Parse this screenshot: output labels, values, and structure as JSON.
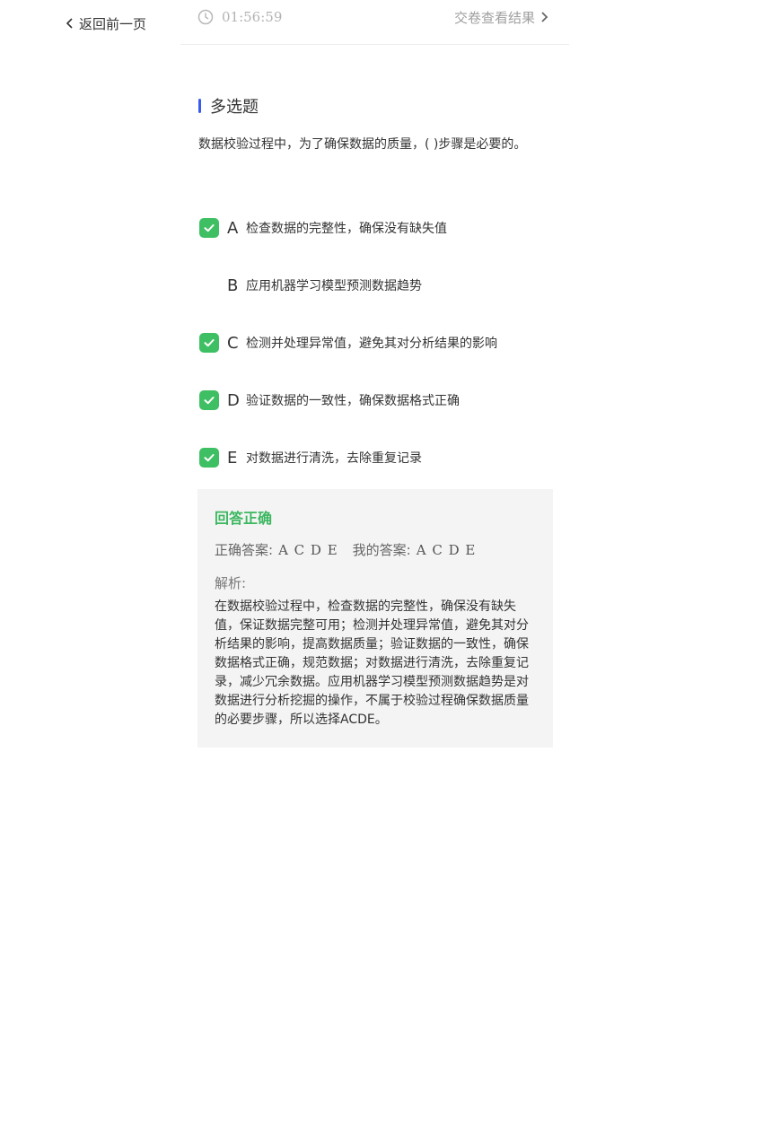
{
  "nav": {
    "back_label": "返回前一页"
  },
  "topbar": {
    "timer": "01:56:59",
    "submit_label": "交卷查看结果"
  },
  "question": {
    "type_label": "多选题",
    "stem": "数据校验过程中，为了确保数据的质量，( )步骤是必要的。",
    "options": [
      {
        "letter": "A",
        "text": "检查数据的完整性，确保没有缺失值",
        "checked": true
      },
      {
        "letter": "B",
        "text": "应用机器学习模型预测数据趋势",
        "checked": false
      },
      {
        "letter": "C",
        "text": "检测并处理异常值，避免其对分析结果的影响",
        "checked": true
      },
      {
        "letter": "D",
        "text": "验证数据的一致性，确保数据格式正确",
        "checked": true
      },
      {
        "letter": "E",
        "text": "对数据进行清洗，去除重复记录",
        "checked": true
      }
    ]
  },
  "result": {
    "status": "回答正确",
    "correct_label": "正确答案:",
    "correct_value": "A C D E",
    "mine_label": "我的答案:",
    "mine_value": "A C D E",
    "analysis_label": "解析:",
    "analysis_text": "在数据校验过程中，检查数据的完整性，确保没有缺失值，保证数据完整可用；检测并处理异常值，避免其对分析结果的影响，提高数据质量；验证数据的一致性，确保数据格式正确，规范数据；对数据进行清洗，去除重复记录，减少冗余数据。应用机器学习模型预测数据趋势是对数据进行分析挖掘的操作，不属于校验过程确保数据质量的必要步骤，所以选择ACDE。"
  },
  "colors": {
    "accent_blue": "#3a5ce8",
    "check_green": "#3fbf63",
    "correct_green": "#3cb760",
    "panel_bg": "#f4f4f4"
  }
}
